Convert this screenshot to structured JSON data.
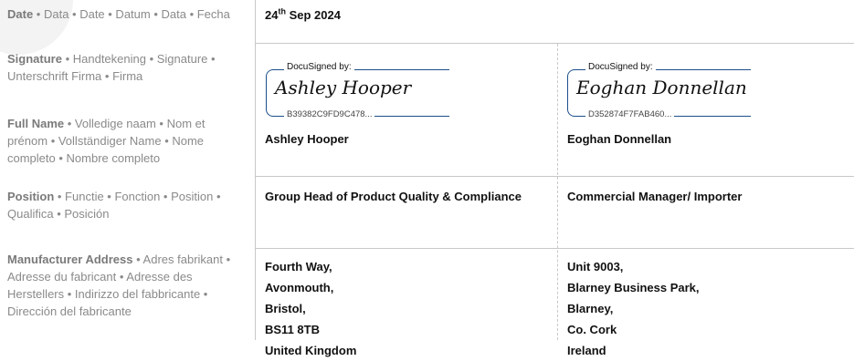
{
  "labels": {
    "date": {
      "bold": "Date",
      "rest": " • Data • Date • Datum • Data • Fecha"
    },
    "signature": {
      "bold": "Signature",
      "rest": " • Handtekening • Signature • Unterschrift Firma • Firma"
    },
    "full_name": {
      "bold": "Full Name",
      "rest": " • Volledige naam • Nom et prénom • Vollständiger Name • Nome completo • Nombre completo"
    },
    "position": {
      "bold": "Position",
      "rest": " • Functie • Fonction • Position • Qualifica • Posición"
    },
    "manufacturer_address": {
      "bold": "Manufacturer Address",
      "rest": " • Adres fabrikant • Adresse du fabricant • Adresse des Herstellers • Indirizzo del fabbricante • Dirección del fabricante"
    }
  },
  "date": {
    "day": "24",
    "suffix": "th",
    "rest": " Sep 2024"
  },
  "signers": [
    {
      "docusigned_label": "DocuSigned by:",
      "signature_script": "Ashley Hooper",
      "envelope_id": "B39382C9FD9C478...",
      "full_name": "Ashley Hooper",
      "position": "Group Head of Product Quality & Compliance",
      "address": [
        "Fourth Way,",
        "Avonmouth,",
        "Bristol,",
        "BS11 8TB",
        "United Kingdom"
      ]
    },
    {
      "docusigned_label": "DocuSigned by:",
      "signature_script": "Eoghan Donnellan",
      "envelope_id": "D352874F7FAB460...",
      "full_name": "Eoghan Donnellan",
      "position": "Commercial Manager/ Importer",
      "address": [
        "Unit 9003,",
        "Blarney Business Park,",
        "Blarney,",
        "Co. Cork",
        "Ireland"
      ]
    }
  ]
}
